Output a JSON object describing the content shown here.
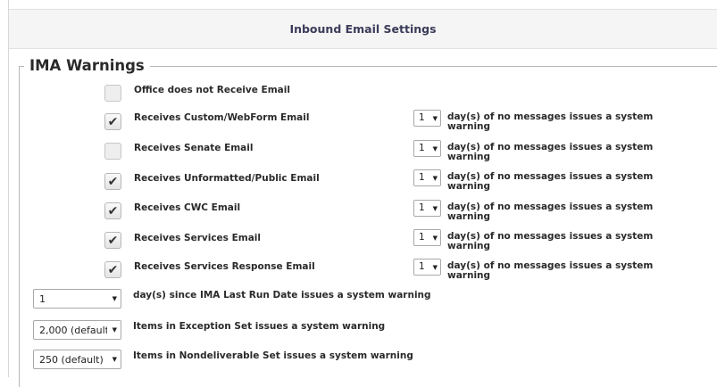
{
  "header": {
    "title": "Inbound Email Settings"
  },
  "section": {
    "legend": "IMA Warnings"
  },
  "first_item": {
    "label": "Office does not Receive Email",
    "checked": false
  },
  "email_types": [
    {
      "label": "Receives Custom/WebForm Email",
      "checked": true,
      "days": "1",
      "warning": "day(s) of no messages issues a system warning"
    },
    {
      "label": "Receives Senate Email",
      "checked": false,
      "days": "1",
      "warning": "day(s) of no messages issues a system warning"
    },
    {
      "label": "Receives Unformatted/Public Email",
      "checked": true,
      "days": "1",
      "warning": "day(s) of no messages issues a system warning"
    },
    {
      "label": "Receives CWC Email",
      "checked": true,
      "days": "1",
      "warning": "day(s) of no messages issues a system warning"
    },
    {
      "label": "Receives Services Email",
      "checked": true,
      "days": "1",
      "warning": "day(s) of no messages issues a system warning"
    },
    {
      "label": "Receives Services Response Email",
      "checked": true,
      "days": "1",
      "warning": "day(s) of no messages issues a system warning"
    }
  ],
  "system_settings": [
    {
      "value": "1",
      "label": "day(s) since IMA Last Run Date issues a system warning"
    },
    {
      "value": "2,000 (default)",
      "label": "Items in Exception Set issues a system warning"
    },
    {
      "value": "250 (default)",
      "label": "Items in Nondeliverable Set issues a system warning"
    }
  ],
  "icons": {
    "checkmark": "checkmark-icon",
    "dropdown": "dropdown-arrow-icon"
  }
}
